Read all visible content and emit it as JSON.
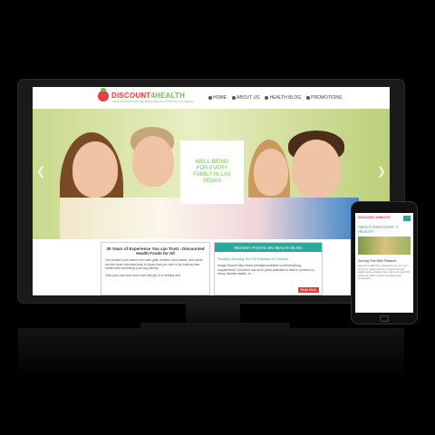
{
  "site": {
    "logo_main": "DISCOUNT",
    "logo_accent": "4HEALTH",
    "logo_tagline": "YOUR SOURCE FOR THE BEST HEALTH FOODS IN LAS VEGAS"
  },
  "nav": {
    "items": [
      {
        "label": "HOME",
        "icon": "home-icon"
      },
      {
        "label": "ABOUT US",
        "icon": "info-icon"
      },
      {
        "label": "HEALTH BLOG",
        "icon": "blog-icon"
      },
      {
        "label": "PROMOTIONS",
        "icon": "tag-icon"
      }
    ]
  },
  "hero": {
    "line1": "WELL-BEING",
    "line2": "FOR EVERY",
    "line3": "FAMILY IN LAS",
    "line4": "VEGAS"
  },
  "intro": {
    "title": "30 Years of Experience You can Trust - Discounted Health Foods for All",
    "body": "You shower your loved ones with gifts, flowers, chocolates, and cards, but the most important way to show that you care is by making their health and well-being your top priority!",
    "body2": "Give your new and dear ones the gift of a healthy and"
  },
  "recent": {
    "header": "RECENT POSTS ON HEALTH BLOG",
    "post_title": "Possibly Unlocking The Full Potential Of Curcumin",
    "post_text": "Image Source:http://www.prestigiousdirtisht.com/everything-supplements Curcumin has such great potential to heal or prevent so many disease states. In...",
    "read_more": "Read More"
  },
  "phone": {
    "logo": "DISCOUNT 4HEALTH",
    "heading": "ABOUT DISCOUNT 4 HEALTH",
    "subheading": "Serving Fine With Pleasure",
    "text": "Discount 4 HEALTH is delighted to be your one source for quality vitamins, supplements and health foods at budget prices. We're the store that carries the latest nutrition & products and accessories..."
  },
  "colors": {
    "brand_red": "#e2403f",
    "brand_green": "#6cc24a",
    "teal": "#2ba79b"
  }
}
